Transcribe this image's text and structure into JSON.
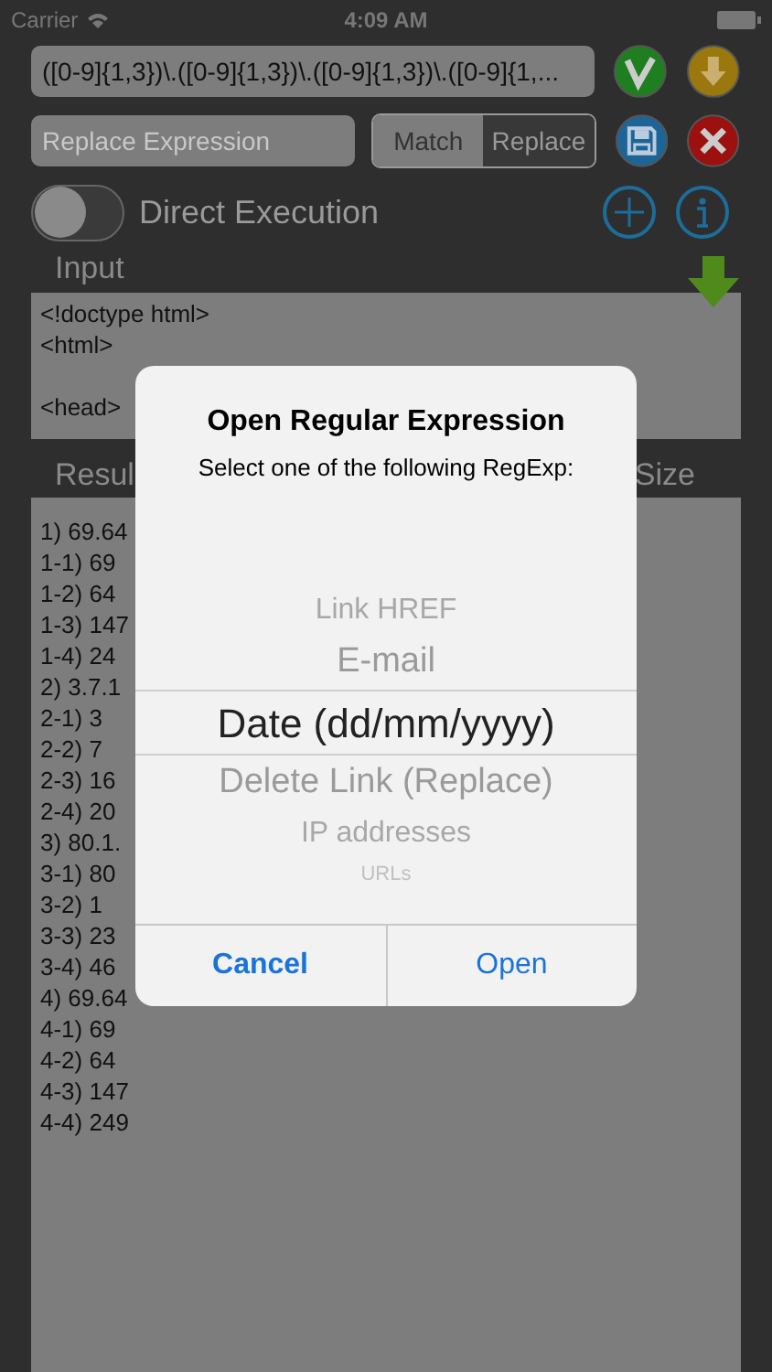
{
  "status_bar": {
    "carrier": "Carrier",
    "time": "4:09 AM"
  },
  "regex_field": {
    "value": "([0-9]{1,3})\\.([0-9]{1,3})\\.([0-9]{1,3})\\.([0-9]{1,..."
  },
  "replace_field": {
    "placeholder": "Replace Expression"
  },
  "mode_segments": [
    {
      "label": "Match",
      "selected": false
    },
    {
      "label": "Replace",
      "selected": true
    }
  ],
  "direct_execution": {
    "label": "Direct Execution",
    "on": false
  },
  "input": {
    "label": "Input",
    "text": "<!doctype html>\n<html>\n\n<head>"
  },
  "results": {
    "label": "Resul",
    "size_label": "Size",
    "lines": [
      "1) 69.64",
      "1-1) 69",
      "1-2) 64",
      "1-3) 147",
      "1-4) 24",
      "2) 3.7.1",
      "2-1) 3",
      "2-2) 7",
      "2-3) 16",
      "2-4) 20",
      "3) 80.1.",
      "3-1) 80",
      "3-2) 1",
      "3-3) 23",
      "3-4) 46",
      "4) 69.64",
      "4-1) 69",
      "4-2) 64",
      "4-3) 147",
      "4-4) 249"
    ]
  },
  "dialog": {
    "title": "Open Regular Expression",
    "message": "Select one of the following RegExp:",
    "options": [
      {
        "label": "Link HREF",
        "selected": false
      },
      {
        "label": "E-mail",
        "selected": false
      },
      {
        "label": "Date (dd/mm/yyyy)",
        "selected": true
      },
      {
        "label": "Delete Link (Replace)",
        "selected": false
      },
      {
        "label": "IP addresses",
        "selected": false
      },
      {
        "label": "URLs",
        "selected": false
      }
    ],
    "buttons": [
      {
        "label": "Cancel",
        "kind": "cancel"
      },
      {
        "label": "Open",
        "kind": "default"
      }
    ]
  }
}
